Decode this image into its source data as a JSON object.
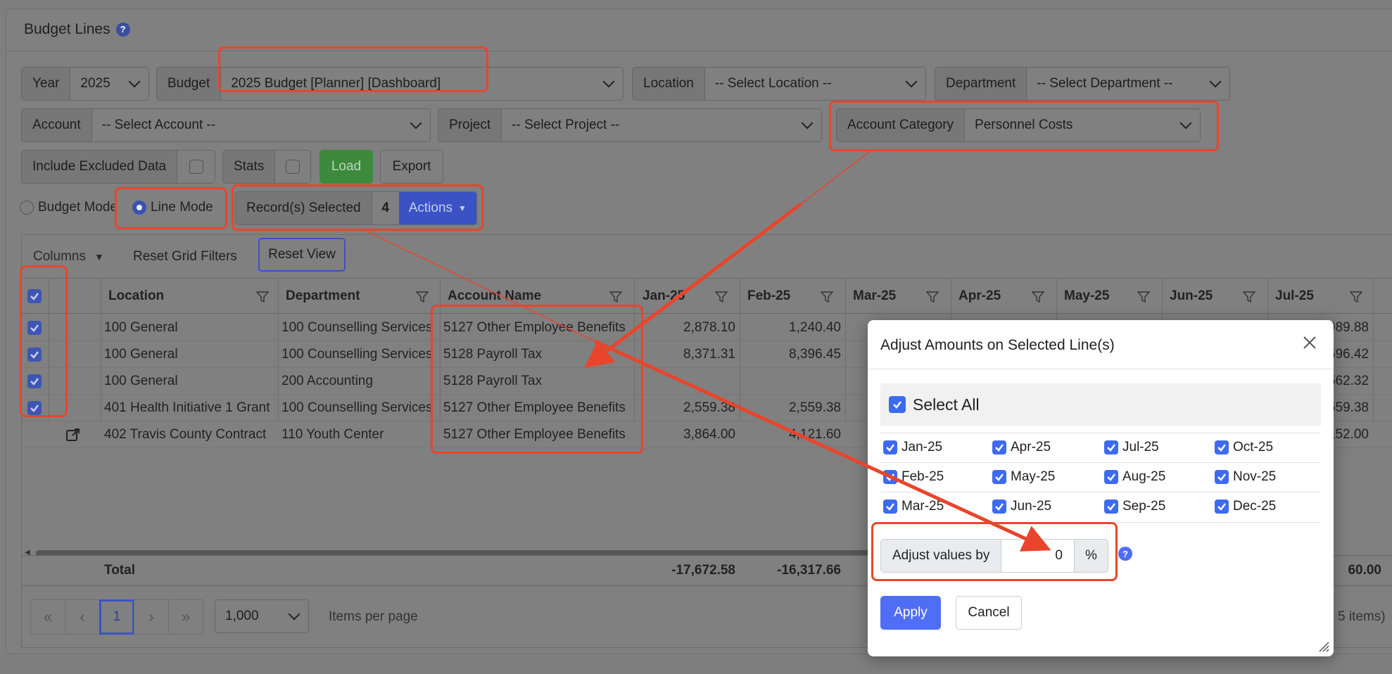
{
  "header": {
    "title": "Budget Lines",
    "help": "?"
  },
  "filters": {
    "year_label": "Year",
    "year_value": "2025",
    "budget_label": "Budget",
    "budget_value": "2025 Budget [Planner] [Dashboard]",
    "location_label": "Location",
    "location_value": "-- Select Location --",
    "department_label": "Department",
    "department_value": "-- Select Department --",
    "account_label": "Account",
    "account_value": "-- Select Account --",
    "project_label": "Project",
    "project_value": "-- Select Project --",
    "account_category_label": "Account Category",
    "account_category_value": "Personnel Costs",
    "include_excluded_label": "Include Excluded Data",
    "stats_label": "Stats",
    "load_label": "Load",
    "export_label": "Export"
  },
  "mode": {
    "budget_mode_label": "Budget Mode",
    "line_mode_label": "Line Mode",
    "selected_mode": "Line Mode",
    "records_selected_label": "Record(s) Selected",
    "records_selected_count": "4",
    "actions_label": "Actions"
  },
  "grid": {
    "toolbar": {
      "columns_label": "Columns",
      "reset_filters_label": "Reset Grid Filters",
      "reset_view_label": "Reset View"
    },
    "columns": [
      "Location",
      "Department",
      "Account Name",
      "Jan-25",
      "Feb-25",
      "Mar-25",
      "Apr-25",
      "May-25",
      "Jun-25",
      "Jul-25"
    ],
    "rows": [
      {
        "checked": true,
        "location": "100 General",
        "department": "100 Counselling Services",
        "account": "5127 Other Employee Benefits",
        "jan": "2,878.10",
        "feb": "1,240.40",
        "jul": "989.88"
      },
      {
        "checked": true,
        "location": "100 General",
        "department": "100 Counselling Services",
        "account": "5128 Payroll Tax",
        "jan": "8,371.31",
        "feb": "8,396.45",
        "jul": "596.42"
      },
      {
        "checked": true,
        "location": "100 General",
        "department": "200 Accounting",
        "account": "5128 Payroll Tax",
        "jan": "",
        "feb": "",
        "jul": "562.32"
      },
      {
        "checked": true,
        "location": "401 Health Initiative 1 Grant",
        "department": "100 Counselling Services",
        "account": "5127 Other Employee Benefits",
        "jan": "2,559.38",
        "feb": "2,559.38",
        "jul": "559.38"
      },
      {
        "checked": false,
        "location": "402 Travis County Contract",
        "department": "110 Youth Center",
        "account": "5127 Other Employee Benefits",
        "jan": "3,864.00",
        "feb": "4,121.60",
        "jul": "152.00"
      }
    ],
    "totals": {
      "label": "Total",
      "jan": "-17,672.58",
      "feb": "-16,317.66",
      "jul": "60.00"
    },
    "pager": {
      "first": "«",
      "prev": "‹",
      "page": "1",
      "next": "›",
      "last": "»",
      "page_size": "1,000",
      "items_per_page_label": "Items per page",
      "items_count": "5 items)"
    }
  },
  "modal": {
    "title": "Adjust Amounts on Selected Line(s)",
    "select_all_label": "Select All",
    "months": [
      "Jan-25",
      "Apr-25",
      "Jul-25",
      "Oct-25",
      "Feb-25",
      "May-25",
      "Aug-25",
      "Nov-25",
      "Mar-25",
      "Jun-25",
      "Sep-25",
      "Dec-25"
    ],
    "adjust_label": "Adjust values by",
    "adjust_value": "0",
    "adjust_unit": "%",
    "help": "?",
    "apply_label": "Apply",
    "cancel_label": "Cancel"
  },
  "colors": {
    "highlight": "#e8452c",
    "primary": "#4f6ef5",
    "load": "#3d8a3d",
    "actions": "#3a52c4"
  }
}
